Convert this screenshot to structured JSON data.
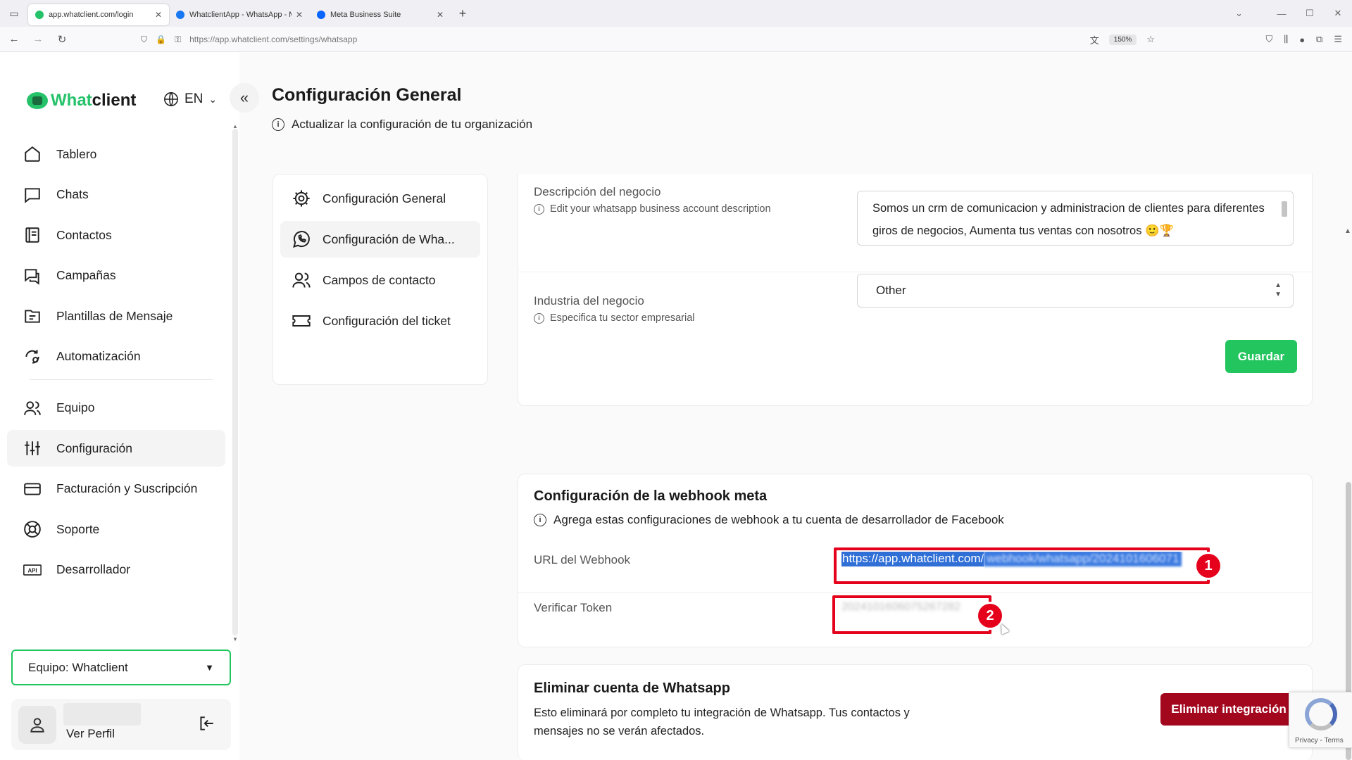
{
  "browser": {
    "tabs": [
      {
        "title": "app.whatclient.com/login",
        "favicon_color": "#25c26a"
      },
      {
        "title": "WhatclientApp - WhatsApp - M",
        "favicon_color": "#1877f2"
      },
      {
        "title": "Meta Business Suite",
        "favicon_color": "#0866ff"
      }
    ],
    "url": "https://app.whatclient.com/settings/whatsapp",
    "zoom": "150%"
  },
  "sidebar": {
    "logo_part1": "Whatclient",
    "logo_w": "What",
    "logo_c": "client",
    "language": "EN",
    "items": [
      {
        "label": "Tablero",
        "icon": "home-icon"
      },
      {
        "label": "Chats",
        "icon": "chat-icon"
      },
      {
        "label": "Contactos",
        "icon": "contacts-icon"
      },
      {
        "label": "Campañas",
        "icon": "campaigns-icon"
      },
      {
        "label": "Plantillas de Mensaje",
        "icon": "templates-icon"
      },
      {
        "label": "Automatización",
        "icon": "automation-icon"
      },
      {
        "label": "Equipo",
        "icon": "team-icon"
      },
      {
        "label": "Configuración",
        "icon": "settings-sliders-icon"
      },
      {
        "label": "Facturación y Suscripción",
        "icon": "credit-card-icon"
      },
      {
        "label": "Soporte",
        "icon": "support-icon"
      },
      {
        "label": "Desarrollador",
        "icon": "api-icon"
      }
    ],
    "team_select": "Equipo: Whatclient",
    "profile_label": "Ver Perfil"
  },
  "main": {
    "title": "Configuración General",
    "subtitle": "Actualizar la configuración de tu organización",
    "subnav": [
      {
        "label": "Configuración General"
      },
      {
        "label": "Configuración de Wha..."
      },
      {
        "label": "Campos de contacto"
      },
      {
        "label": "Configuración del ticket"
      }
    ],
    "business": {
      "description_label": "Descripción del negocio",
      "description_help": "Edit your whatsapp business account description",
      "description_value": "Somos un crm de comunicacion y administracion de clientes para diferentes giros de negocios, Aumenta tus ventas con nosotros 🙂🏆",
      "industry_label": "Industria del negocio",
      "industry_help": "Especifica tu sector empresarial",
      "industry_value": "Other",
      "save_label": "Guardar"
    },
    "webhook": {
      "title": "Configuración de la webhook meta",
      "description": "Agrega estas configuraciones de webhook a tu cuenta de desarrollador de Facebook",
      "url_label": "URL del Webhook",
      "url_value": "https://app.whatclient.com/",
      "url_blurred": "webhook/whatsapp/2024101606071",
      "token_label": "Verificar Token",
      "token_blurred": "2024101606075267282",
      "annotation_1": "1",
      "annotation_2": "2",
      "annotation_color": "#e5001b"
    },
    "delete": {
      "title": "Eliminar cuenta de Whatsapp",
      "description": "Esto eliminará por completo tu integración de Whatsapp. Tus contactos y mensajes no se verán afectados.",
      "button_label": "Eliminar integración"
    }
  },
  "recaptcha": {
    "links": "Privacy - Terms"
  },
  "colors": {
    "accent_green": "#22c55e",
    "danger": "#a3071e",
    "selection": "#2f6fd6"
  }
}
